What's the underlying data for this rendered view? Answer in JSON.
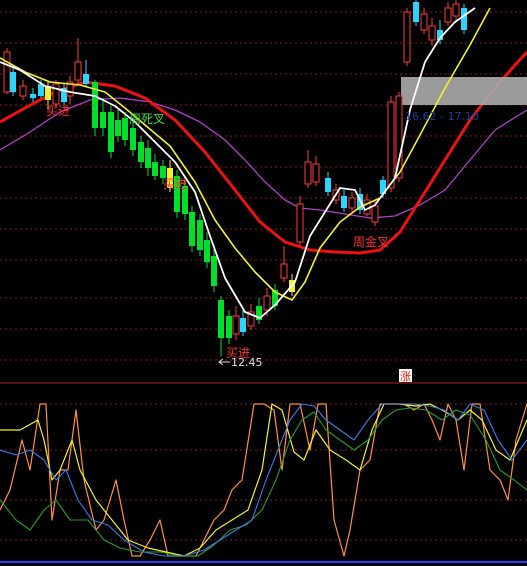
{
  "colors": {
    "background": "#000000",
    "grid": "#8a1c1c",
    "divider": "#b81a1a",
    "up_candle": "#ff3a3a",
    "down_candle": "#00e02a",
    "flat_candle": "#2ad6ff",
    "ma_white": "#ffffff",
    "ma_yellow": "#f2f22a",
    "ma_red": "#ee1111",
    "ma_magenta": "#b040c8",
    "signal_text": "#ff3030",
    "death_cross_text": "#40e040",
    "price_box": "#a8a8a8",
    "price_box_text": "#1a3fa0",
    "low_text": "#e0e0e0",
    "osc_orange": "#ff9040",
    "osc_yellow": "#f2f22a",
    "osc_green": "#2a9a2a",
    "osc_blue": "#3a7ae8",
    "osc_base_blue": "#2040ff"
  },
  "annotations": {
    "buy_1": "买进",
    "buy_2": "买进",
    "buy_3": "买进",
    "weekly_death_cross": "周死叉",
    "weekly_golden_cross": "周金叉",
    "low_price_label": "12.45",
    "price_range_label": "16.62 - 17.10",
    "limit_up_badge": "涨"
  },
  "chart_data": {
    "type": "candlestick",
    "panels": [
      "price",
      "oscillator"
    ],
    "price_low": 12.45,
    "price_range_shown": [
      16.62,
      17.1
    ],
    "moving_averages": [
      "white",
      "yellow",
      "red",
      "magenta"
    ],
    "oscillator_lines": [
      "orange",
      "yellow",
      "green",
      "blue"
    ],
    "oscillator_range": [
      0,
      100
    ],
    "grid": true
  }
}
